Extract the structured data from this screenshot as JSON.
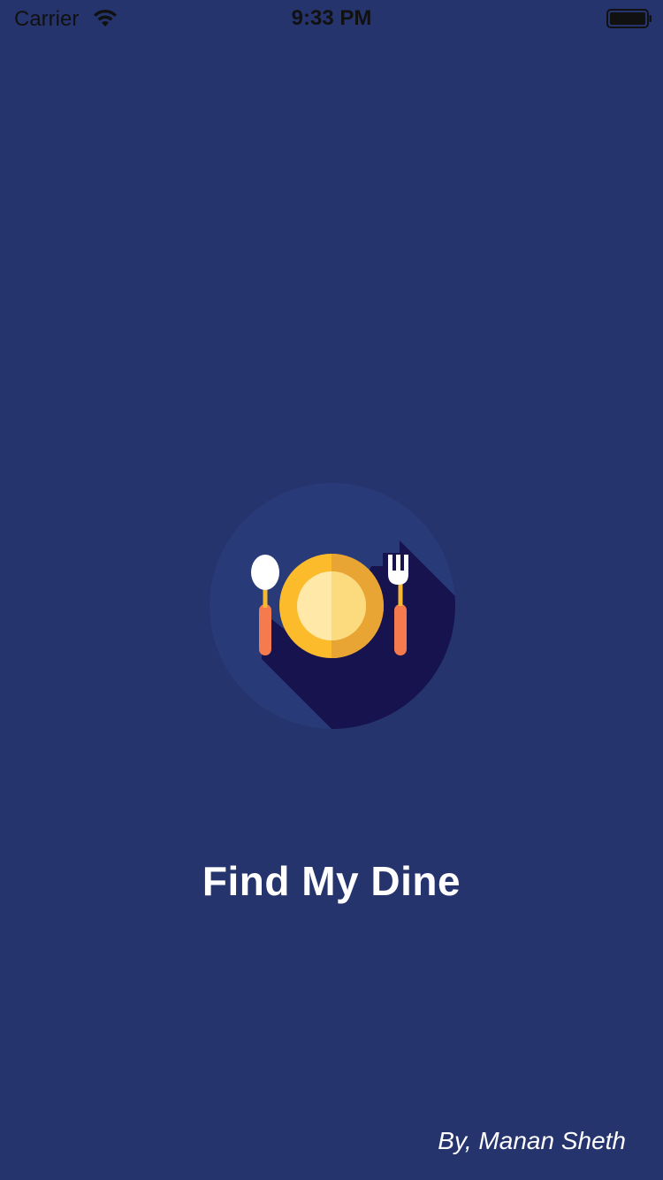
{
  "status_bar": {
    "carrier": "Carrier",
    "time": "9:33 PM",
    "wifi_icon": "wifi-icon",
    "battery_icon": "battery-icon"
  },
  "splash": {
    "logo_icon": "plate-with-spoon-and-fork-icon",
    "title": "Find My Dine",
    "author": "By, Manan Sheth"
  },
  "colors": {
    "background": "#25346D",
    "logo_circle": "#283A78",
    "logo_shadow": "#16134F",
    "plate_outer": "#FBBB2A",
    "plate_outer_shade": "#E9A534",
    "plate_inner": "#FFE8A8",
    "plate_inner_shade": "#FCDB7E",
    "utensil_handle": "#F57A4E",
    "utensil_neck": "#F5B82E",
    "utensil_head": "#FFFFFF",
    "text": "#FFFFFF"
  }
}
